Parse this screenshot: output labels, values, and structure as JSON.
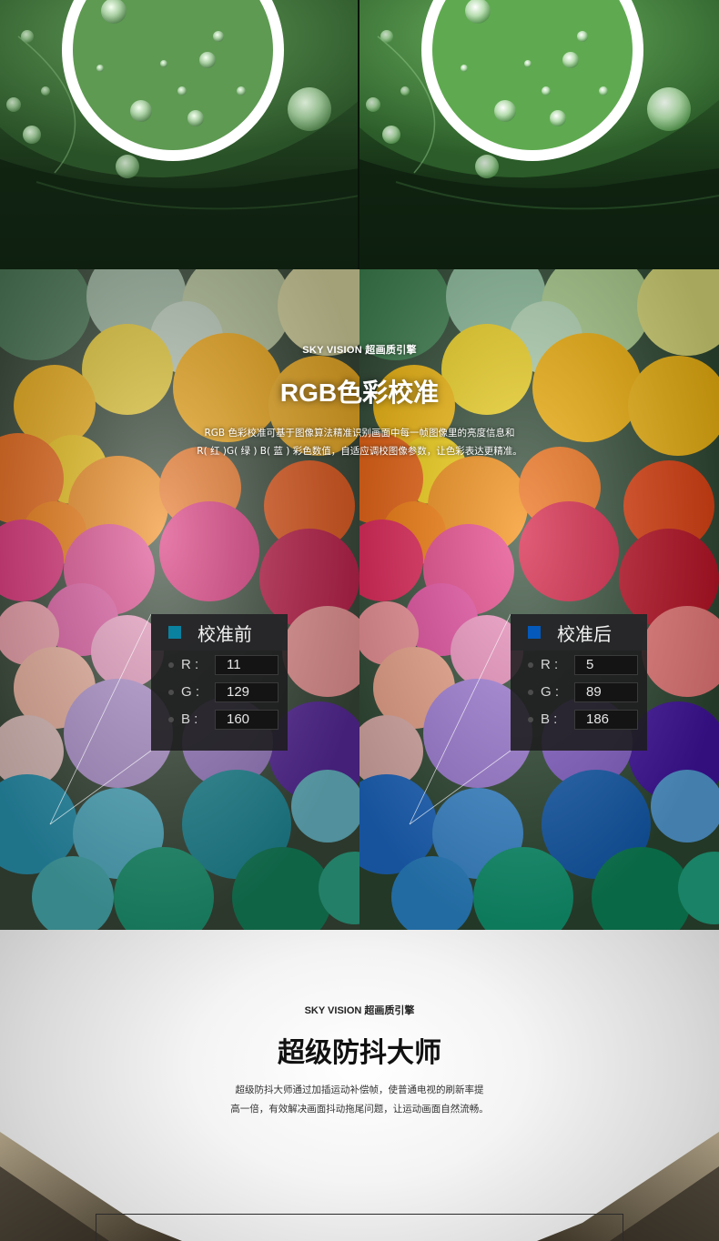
{
  "yarn": {
    "eyebrow": "SKY VISION 超画质引擎",
    "title": "RGB色彩校准",
    "desc_line1": "RGB 色彩校准可基于图像算法精准识别画面中每一帧图像里的亮度信息和",
    "desc_line2": "R( 红 )G( 绿 ) B( 蓝 ) 彩色数值，自适应调校图像参数，让色彩表达更精准。",
    "before": {
      "title": "校准前",
      "swatch_color": "#0b81a0",
      "r_label": "R :",
      "r_value": "11",
      "g_label": "G :",
      "g_value": "129",
      "b_label": "B :",
      "b_value": "160"
    },
    "after": {
      "title": "校准后",
      "swatch_color": "#0559ba",
      "r_label": "R :",
      "r_value": "5",
      "g_label": "G :",
      "g_value": "89",
      "b_label": "B :",
      "b_value": "186"
    }
  },
  "shake": {
    "eyebrow": "SKY VISION 超画质引擎",
    "title": "超级防抖大师",
    "desc_line1": "超级防抖大师通过加插运动补偿帧，使普通电视的刷新率提",
    "desc_line2": "高一倍，有效解决画面抖动拖尾问题，让运动画面自然流畅。"
  }
}
